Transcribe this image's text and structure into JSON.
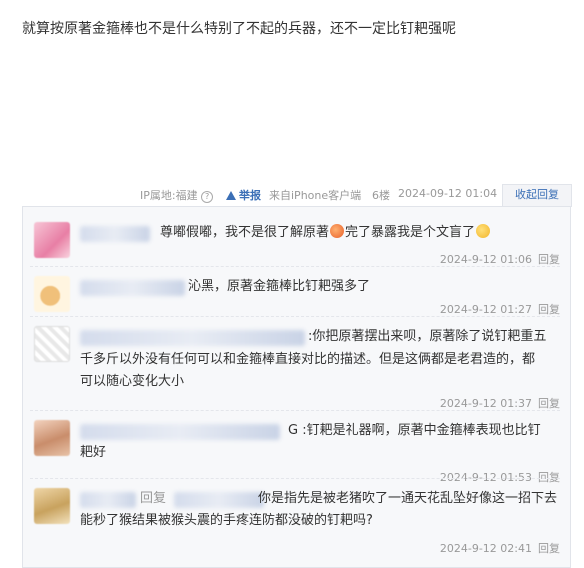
{
  "post": {
    "text": "就算按原著金箍棒也不是什么特别了不起的兵器，还不一定比钉耙强呢"
  },
  "meta": {
    "ip": "IP属地:福建",
    "help": "?",
    "report": "举报",
    "source": "来自iPhone客户端",
    "floor": "6楼",
    "time": "2024-09-12 01:04",
    "collapse": "收起回复"
  },
  "replies": [
    {
      "text_a": "尊嘟假嘟，我不是很了解原著",
      "text_b": "完了暴露我是个文盲了",
      "time": "2024-9-12 01:06",
      "reply": "回复"
    },
    {
      "text": "沁黑，原著金箍棒比钉耙强多了",
      "time": "2024-9-12 01:27",
      "reply": "回复"
    },
    {
      "line1": ":你把原著摆出来呗，原著除了说钉耙重五",
      "line2": "千多斤以外没有任何可以和金箍棒直接对比的描述。但是这俩都是老君造的，都",
      "line3": "可以随心变化大小",
      "time": "2024-9-12 01:37",
      "reply": "回复"
    },
    {
      "line1": "G :钉耙是礼器啊，原著中金箍棒表现也比钉",
      "line2": "耙好",
      "time": "2024-9-12 01:53",
      "reply": "回复"
    },
    {
      "prefix": "回复",
      "line1": "你是指先是被老猪吹了一通天花乱坠好像这一招下去",
      "line2": "能秒了猴结果被猴头震的手疼连防都没破的钉耙吗?",
      "time": "2024-9-12 02:41",
      "reply": "回复"
    }
  ]
}
